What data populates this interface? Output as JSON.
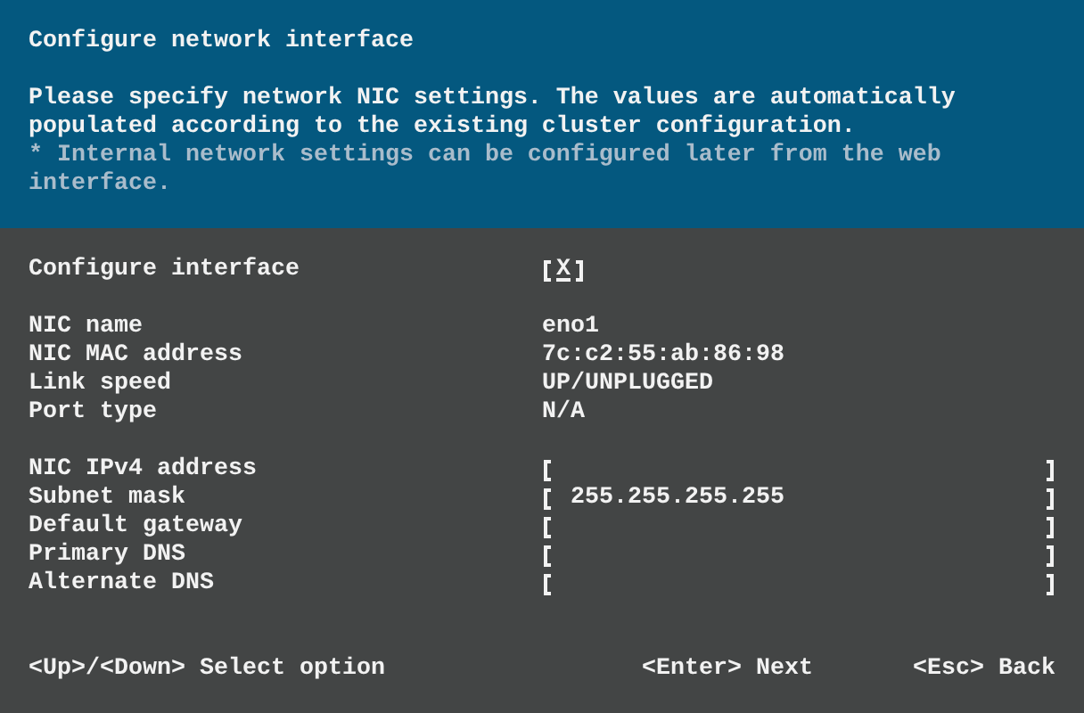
{
  "header": {
    "title": "Configure network interface",
    "description": "Please specify network NIC settings. The values are automatically populated according to the existing cluster configuration.",
    "note": "* Internal network settings can be configured later from the web interface."
  },
  "configure_interface": {
    "label": "Configure interface",
    "checked": true,
    "mark": "X",
    "focused": true
  },
  "info": [
    {
      "label": "NIC name",
      "value": "eno1"
    },
    {
      "label": "NIC MAC address",
      "value": "7c:c2:55:ab:86:98"
    },
    {
      "label": "Link speed",
      "value": "UP/UNPLUGGED"
    },
    {
      "label": "Port type",
      "value": "N/A"
    }
  ],
  "fields": [
    {
      "label": "NIC IPv4 address"
    },
    {
      "label": "Subnet mask",
      "value": "255.255.255.255"
    },
    {
      "label": "Default gateway"
    },
    {
      "label": "Primary DNS"
    },
    {
      "label": "Alternate DNS"
    }
  ],
  "footer": [
    {
      "keys": "<Up>/<Down>",
      "action": "Select option"
    },
    {
      "keys": "<Enter>",
      "action": "Next"
    },
    {
      "keys": "<Esc>",
      "action": "Back"
    }
  ]
}
